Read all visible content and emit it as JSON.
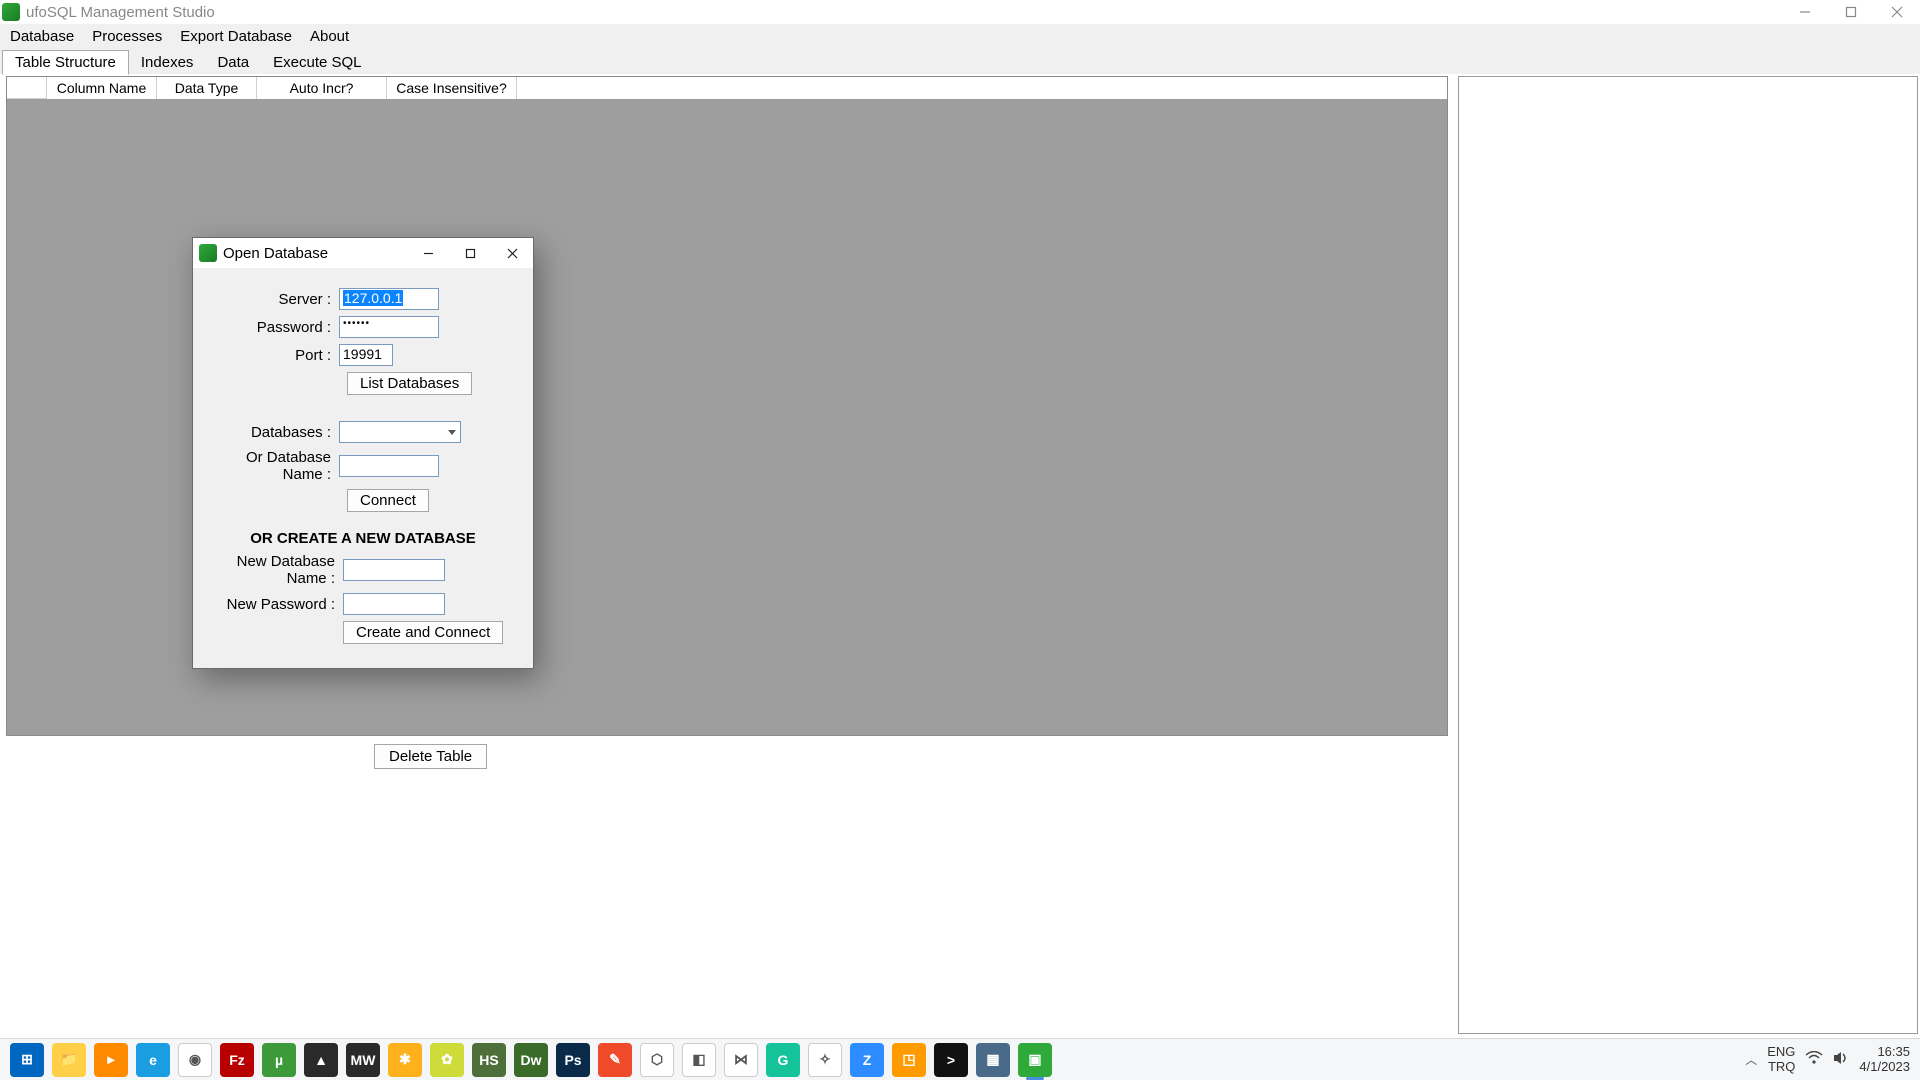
{
  "window": {
    "title": "ufoSQL Management Studio"
  },
  "menubar": {
    "database": "Database",
    "processes": "Processes",
    "export": "Export Database",
    "about": "About"
  },
  "tabs": {
    "structure": "Table Structure",
    "indexes": "Indexes",
    "data": "Data",
    "execute": "Execute SQL"
  },
  "grid_headers": {
    "col1": "Column Name",
    "col2": "Data Type",
    "col3": "Auto Incr?",
    "col4": "Case Insensitive?"
  },
  "buttons": {
    "delete_table": "Delete Table"
  },
  "dialog": {
    "title": "Open Database",
    "labels": {
      "server": "Server :",
      "password": "Password :",
      "port": "Port :",
      "databases": "Databases :",
      "or_db_name": "Or Database Name :",
      "new_db_name": "New Database Name :",
      "new_password": "New Password :"
    },
    "values": {
      "server": "127.0.0.1",
      "password": "••••••",
      "port": "19991",
      "database_selected": "",
      "or_db_name": "",
      "new_db_name": "",
      "new_password": ""
    },
    "buttons": {
      "list_databases": "List Databases",
      "connect": "Connect",
      "create_connect": "Create and Connect"
    },
    "section_header": "OR CREATE A NEW DATABASE"
  },
  "systray": {
    "lang1": "ENG",
    "lang2": "TRQ",
    "time": "16:35",
    "date": "4/1/2023"
  },
  "taskbar_icons": [
    {
      "name": "start-icon",
      "bg": "#0067c0",
      "txt": "⊞"
    },
    {
      "name": "file-explorer-icon",
      "bg": "#ffcf48",
      "txt": "📁"
    },
    {
      "name": "media-player-icon",
      "bg": "#ff8a00",
      "txt": "▸"
    },
    {
      "name": "edge-icon",
      "bg": "#1b9de2",
      "txt": "e"
    },
    {
      "name": "chrome-icon",
      "bg": "#ffffff",
      "txt": "◉"
    },
    {
      "name": "filezilla-icon",
      "bg": "#b80000",
      "txt": "Fz"
    },
    {
      "name": "utorrent-icon",
      "bg": "#3c9a38",
      "txt": "µ"
    },
    {
      "name": "app-icon-1",
      "bg": "#2a2a2a",
      "txt": "▲"
    },
    {
      "name": "app-icon-2",
      "bg": "#2a2a2a",
      "txt": "MW"
    },
    {
      "name": "app-icon-3",
      "bg": "#ffb11b",
      "txt": "✱"
    },
    {
      "name": "app-icon-4",
      "bg": "#cddc39",
      "txt": "✿"
    },
    {
      "name": "heidisql-icon",
      "bg": "#4f6f3a",
      "txt": "HS"
    },
    {
      "name": "dreamweaver-icon",
      "bg": "#3a6b28",
      "txt": "Dw"
    },
    {
      "name": "photoshop-icon",
      "bg": "#0a2a4a",
      "txt": "Ps"
    },
    {
      "name": "app-icon-5",
      "bg": "#ef4a2a",
      "txt": "✎"
    },
    {
      "name": "app-icon-6",
      "bg": "#ffffff",
      "txt": "⬡"
    },
    {
      "name": "app-icon-7",
      "bg": "#ffffff",
      "txt": "◧"
    },
    {
      "name": "visual-studio-icon",
      "bg": "#ffffff",
      "txt": "⋈"
    },
    {
      "name": "grammarly-icon",
      "bg": "#15c39a",
      "txt": "G"
    },
    {
      "name": "app-icon-8",
      "bg": "#ffffff",
      "txt": "✧"
    },
    {
      "name": "zoom-icon",
      "bg": "#2d8cff",
      "txt": "Z"
    },
    {
      "name": "app-icon-9",
      "bg": "#ff9a00",
      "txt": "◳"
    },
    {
      "name": "terminal-icon",
      "bg": "#111111",
      "txt": ">"
    },
    {
      "name": "calculator-icon",
      "bg": "#4a6a8a",
      "txt": "▦"
    },
    {
      "name": "ufosql-taskbar-icon",
      "bg": "#2faa3a",
      "txt": "▣"
    }
  ]
}
